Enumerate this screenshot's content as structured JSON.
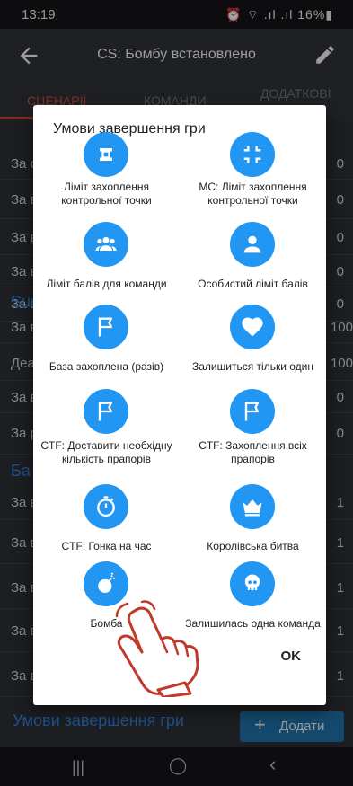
{
  "status": {
    "time": "13:19",
    "right": "⏰ ⌔ .ıl .ıl 16%▮"
  },
  "appbar": {
    "title": "CS: Бомбу встановлено"
  },
  "tabs": [
    "Сценарії",
    "Команди",
    "Додаткові"
  ],
  "background": {
    "rows_top": [
      {
        "label": "За с",
        "value": "0"
      },
      {
        "label": "За в",
        "value": "0"
      },
      {
        "label": "За в",
        "value": "0"
      },
      {
        "label": "За в",
        "value": "0"
      },
      {
        "label": "За в",
        "value": "0"
      }
    ],
    "section1": "Sur",
    "rows_mid": [
      {
        "label": "За в",
        "value": "100"
      },
      {
        "label": "Деа",
        "value": "100"
      },
      {
        "label": "За в",
        "value": "0"
      },
      {
        "label": "За р",
        "value": "0"
      }
    ],
    "section2": "Ба",
    "rows_bottom": [
      {
        "label": "За в",
        "value": "1"
      },
      {
        "label": "За в",
        "value": "1"
      },
      {
        "label": "За в",
        "value": "1"
      },
      {
        "label": "За в",
        "value": "1"
      },
      {
        "label": "За в",
        "value": "1"
      }
    ],
    "bottom_label": "Умови завершення гри",
    "add_label": "Додати"
  },
  "dialog": {
    "title": "Умови завершення гри",
    "ok": "OK",
    "options": [
      {
        "label": "Ліміт захоплення контрольної точки",
        "icon": "control-point-icon"
      },
      {
        "label": "MC: Ліміт захоплення контрольної точки",
        "icon": "compress-icon"
      },
      {
        "label": "Ліміт балів для команди",
        "icon": "group-icon"
      },
      {
        "label": "Особистий ліміт балів",
        "icon": "person-icon"
      },
      {
        "label": "База захоплена (разів)",
        "icon": "flag-icon"
      },
      {
        "label": "Залишиться тільки один",
        "icon": "heart-icon"
      },
      {
        "label": "CTF: Доставити необхідну кількість прапорів",
        "icon": "flag-icon"
      },
      {
        "label": "CTF: Захоплення всіх прапорів",
        "icon": "flag-icon"
      },
      {
        "label": "CTF: Гонка на час",
        "icon": "stopwatch-icon"
      },
      {
        "label": "Королівська битва",
        "icon": "crown-icon"
      },
      {
        "label": "Бомба",
        "icon": "bomb-icon"
      },
      {
        "label": "Залишилась одна команда",
        "icon": "skull-icon"
      }
    ]
  },
  "colors": {
    "accent": "#2196f3",
    "tab_active": "#c9483a",
    "section": "#2f7fd9"
  }
}
